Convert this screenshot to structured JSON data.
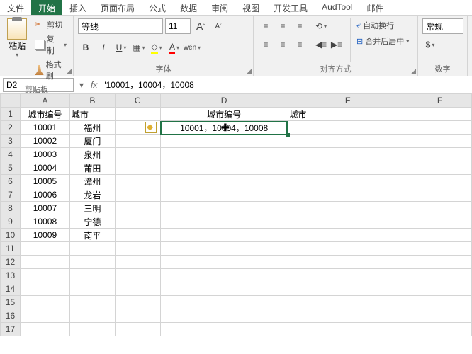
{
  "tabs": [
    "文件",
    "开始",
    "插入",
    "页面布局",
    "公式",
    "数据",
    "审阅",
    "视图",
    "开发工具",
    "AudTool",
    "邮件"
  ],
  "active_tab": 1,
  "ribbon": {
    "clipboard": {
      "label": "剪贴板",
      "paste": "粘贴",
      "cut": "剪切",
      "copy": "复制",
      "format_painter": "格式刷"
    },
    "font": {
      "label": "字体",
      "name": "等线",
      "size": "11"
    },
    "align": {
      "label": "对齐方式",
      "wrap": "自动换行",
      "merge": "合并后居中"
    },
    "number": {
      "label": "数字",
      "format": "常规"
    }
  },
  "namebox": "D2",
  "formula": "'10001，10004，10008",
  "cols": [
    "A",
    "B",
    "C",
    "D",
    "E",
    "F"
  ],
  "rows": [
    [
      "城市编号",
      "城市",
      "",
      "城市编号",
      "城市",
      ""
    ],
    [
      "10001",
      "福州",
      "",
      "10001，10004，10008",
      "",
      ""
    ],
    [
      "10002",
      "厦门",
      "",
      "",
      "",
      ""
    ],
    [
      "10003",
      "泉州",
      "",
      "",
      "",
      ""
    ],
    [
      "10004",
      "莆田",
      "",
      "",
      "",
      ""
    ],
    [
      "10005",
      "漳州",
      "",
      "",
      "",
      ""
    ],
    [
      "10006",
      "龙岩",
      "",
      "",
      "",
      ""
    ],
    [
      "10007",
      "三明",
      "",
      "",
      "",
      ""
    ],
    [
      "10008",
      "宁德",
      "",
      "",
      "",
      ""
    ],
    [
      "10009",
      "南平",
      "",
      "",
      "",
      ""
    ],
    [
      "",
      "",
      "",
      "",
      "",
      ""
    ],
    [
      "",
      "",
      "",
      "",
      "",
      ""
    ],
    [
      "",
      "",
      "",
      "",
      "",
      ""
    ],
    [
      "",
      "",
      "",
      "",
      "",
      ""
    ],
    [
      "",
      "",
      "",
      "",
      "",
      ""
    ],
    [
      "",
      "",
      "",
      "",
      "",
      ""
    ],
    [
      "",
      "",
      "",
      "",
      "",
      ""
    ]
  ],
  "center_cols": {
    "0": [
      0,
      3
    ],
    "1": [
      0,
      1,
      3
    ],
    "2": [
      0,
      1
    ],
    "3": [
      0,
      1
    ],
    "4": [
      0,
      1
    ],
    "5": [
      0,
      1
    ],
    "6": [
      0,
      1
    ],
    "7": [
      0,
      1
    ],
    "8": [
      0,
      1
    ],
    "9": [
      0,
      1
    ]
  }
}
